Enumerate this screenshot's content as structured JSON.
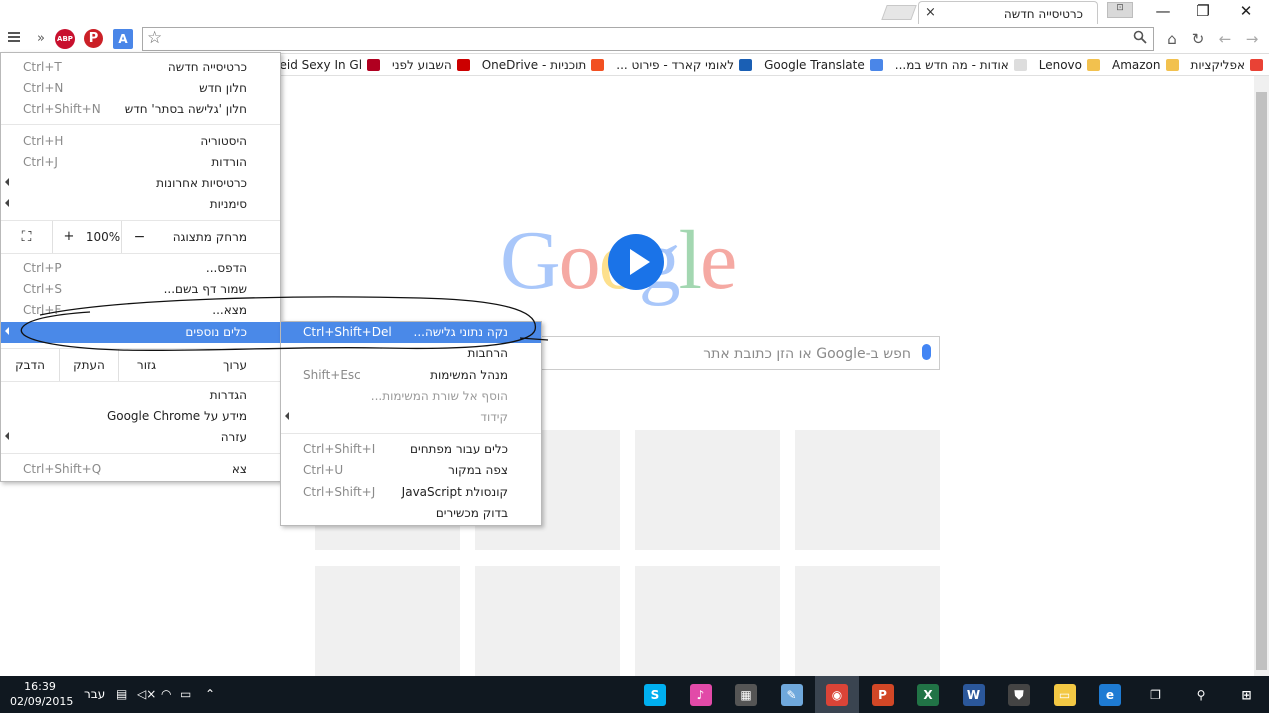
{
  "window": {
    "tab_title": "כרטיסייה חדשה",
    "tab_close": "×",
    "minimize": "—",
    "restore": "❐",
    "close": "✕"
  },
  "toolbar": {
    "menu_icon": "hamburger-icon",
    "overflow": "»",
    "abp_label": "ABP",
    "pinterest_label": "P",
    "translate_label": "A",
    "star": "☆",
    "search": "⚲",
    "home": "⌂",
    "reload": "↻",
    "back": "←",
    "forward": "→"
  },
  "bookmarks": [
    {
      "label": "אפליקציות",
      "icon": "apps-grid-icon",
      "color": "#e94235"
    },
    {
      "label": "Amazon",
      "icon": "folder-icon",
      "color": "#f2c14e"
    },
    {
      "label": "Lenovo",
      "icon": "folder-icon",
      "color": "#f2c14e"
    },
    {
      "label": "אודות - מה חדש במ...",
      "icon": "page-icon",
      "color": "#dddddd"
    },
    {
      "label": "Google Translate",
      "icon": "translate-icon",
      "color": "#4a86e8"
    },
    {
      "label": "לאומי קארד - פירוט ...",
      "icon": "globe-icon",
      "color": "#1a5fb4"
    },
    {
      "label": "תוכניות - OneDrive",
      "icon": "microsoft-icon",
      "color": "#f25022"
    },
    {
      "label": "השבוע לפני",
      "icon": "ynet-icon",
      "color": "#cc0000"
    },
    {
      "label": "Riley Reid Sexy In Gl...",
      "icon": "r-icon",
      "color": "#b00020"
    }
  ],
  "main_menu": {
    "items": [
      {
        "label": "כרטיסייה חדשה",
        "shortcut": "Ctrl+T"
      },
      {
        "label": "חלון חדש",
        "shortcut": "Ctrl+N"
      },
      {
        "label": "חלון 'גלישה בסתר' חדש",
        "shortcut": "Ctrl+Shift+N"
      },
      {
        "label": "היסטוריה",
        "shortcut": "Ctrl+H"
      },
      {
        "label": "הורדות",
        "shortcut": "Ctrl+J"
      },
      {
        "label": "כרטיסיות אחרונות",
        "shortcut": ""
      },
      {
        "label": "סימניות",
        "shortcut": ""
      },
      {
        "label": "הדפס...",
        "shortcut": "Ctrl+P"
      },
      {
        "label": "שמור דף בשם...",
        "shortcut": "Ctrl+S"
      },
      {
        "label": "מצא...",
        "shortcut": "Ctrl+F"
      },
      {
        "label": "כלים נוספים",
        "shortcut": ""
      },
      {
        "label": "הגדרות",
        "shortcut": ""
      },
      {
        "label": "מידע על Google Chrome",
        "shortcut": ""
      },
      {
        "label": "עזרה",
        "shortcut": ""
      },
      {
        "label": "צא",
        "shortcut": "Ctrl+Shift+Q"
      }
    ],
    "zoom": {
      "label": "מרחק מתצוגה",
      "minus": "−",
      "value": "100%",
      "plus": "+",
      "fullscreen": "⛶"
    },
    "edit": {
      "label": "ערוך",
      "cut": "גזור",
      "copy": "העתק",
      "paste": "הדבק"
    }
  },
  "sub_menu": {
    "items": [
      {
        "label": "נקה נתוני גלישה...",
        "shortcut": "Ctrl+Shift+Del"
      },
      {
        "label": "הרחבות",
        "shortcut": ""
      },
      {
        "label": "מנהל המשימות",
        "shortcut": "Shift+Esc"
      },
      {
        "label": "הוסף אל שורת המשימות...",
        "shortcut": ""
      },
      {
        "label": "קידוד",
        "shortcut": ""
      },
      {
        "label": "כלים עבור מפתחים",
        "shortcut": "Ctrl+Shift+I"
      },
      {
        "label": "צפה במקור",
        "shortcut": "Ctrl+U"
      },
      {
        "label": "קונסולת JavaScript",
        "shortcut": "Ctrl+Shift+J"
      },
      {
        "label": "בדוק מכשירים",
        "shortcut": ""
      }
    ]
  },
  "page": {
    "logo_letters": [
      "G",
      "o",
      "o",
      "g",
      "l",
      "e"
    ],
    "logo_colors": [
      "#4285f4",
      "#ea4335",
      "#fbbc05",
      "#4285f4",
      "#34a853",
      "#ea4335"
    ],
    "search_placeholder": "חפש ב-Google או הזן כתובת אתר"
  },
  "taskbar": {
    "time": "16:39",
    "date": "02/09/2015",
    "lang": "עבר",
    "apps": [
      {
        "name": "skype-icon",
        "glyph": "S",
        "color": "#00aff0"
      },
      {
        "name": "itunes-icon",
        "glyph": "♪",
        "color": "#e24aa8"
      },
      {
        "name": "calculator-icon",
        "glyph": "▦",
        "color": "#555555"
      },
      {
        "name": "paint-icon",
        "glyph": "✎",
        "color": "#6fa8dc"
      },
      {
        "name": "chrome-icon",
        "glyph": "◉",
        "color": "#db4437"
      },
      {
        "name": "powerpoint-icon",
        "glyph": "P",
        "color": "#d24726"
      },
      {
        "name": "excel-icon",
        "glyph": "X",
        "color": "#217346"
      },
      {
        "name": "word-icon",
        "glyph": "W",
        "color": "#2b579a"
      },
      {
        "name": "store-icon",
        "glyph": "⛊",
        "color": "#444444"
      },
      {
        "name": "explorer-icon",
        "glyph": "▭",
        "color": "#f3c844"
      },
      {
        "name": "edge-icon",
        "glyph": "e",
        "color": "#1e7bd3"
      },
      {
        "name": "task-view-icon",
        "glyph": "❐",
        "color": "#101820"
      },
      {
        "name": "search-icon",
        "glyph": "⚲",
        "color": "#101820"
      },
      {
        "name": "start-icon",
        "glyph": "⊞",
        "color": "#101820"
      }
    ]
  }
}
